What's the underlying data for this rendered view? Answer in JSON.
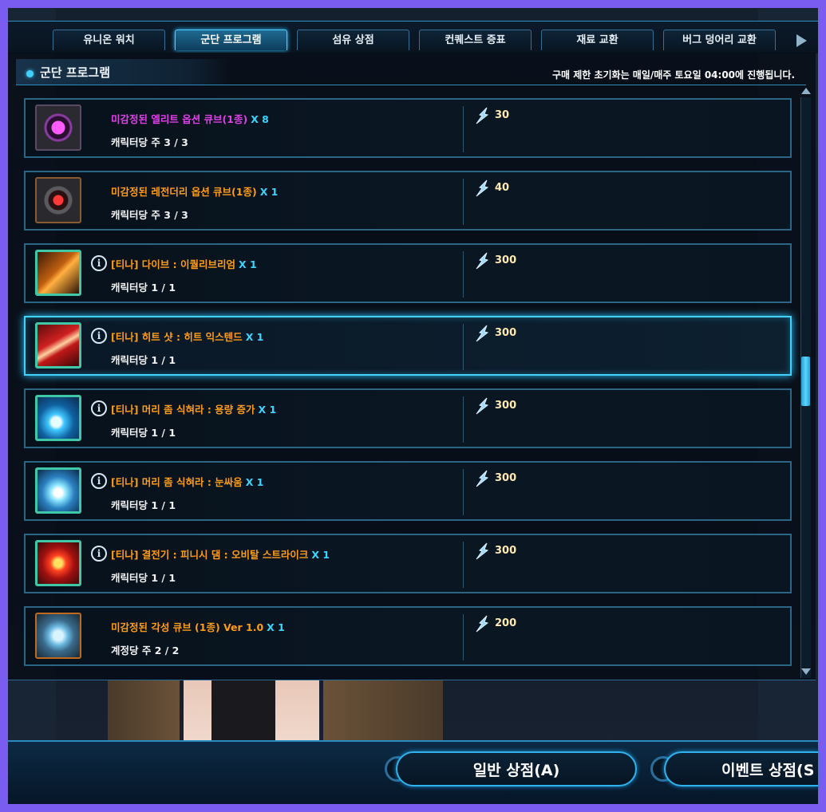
{
  "tabs": [
    {
      "label": "유니온 워치",
      "active": false
    },
    {
      "label": "군단 프로그램",
      "active": true
    },
    {
      "label": "섬유 상점",
      "active": false
    },
    {
      "label": "컨퀘스트 증표",
      "active": false
    },
    {
      "label": "재료 교환",
      "active": false
    },
    {
      "label": "버그 덩어리 교환",
      "active": false
    }
  ],
  "section": {
    "title": "군단 프로그램",
    "notice": "구매 제한 초기화는 매일/매주 토요일 04:00에 진행됩니다."
  },
  "items": [
    {
      "name": "미감정된 엘리트 옵션 큐브(1종)",
      "qty": "X 8",
      "limit": "캐릭터당 주 3 / 3",
      "price": "30",
      "info": false,
      "name_color": "purple",
      "icon": "elite-cube-icon"
    },
    {
      "name": "미감정된 레전더리 옵션 큐브(1종)",
      "qty": "X 1",
      "limit": "캐릭터당 주 3 / 3",
      "price": "40",
      "info": false,
      "name_color": "orange",
      "icon": "legendary-cube-icon"
    },
    {
      "name": "[티나] 다이브 : 이퀄리브리엄",
      "qty": "X 1",
      "limit": "캐릭터당 1 / 1",
      "price": "300",
      "info": true,
      "name_color": "orange",
      "icon": "skill-dive-icon"
    },
    {
      "name": "[티나] 히트 샷 : 히트 익스텐드",
      "qty": "X 1",
      "limit": "캐릭터당 1 / 1",
      "price": "300",
      "info": true,
      "name_color": "orange",
      "icon": "skill-heat-shot-icon",
      "selected": true
    },
    {
      "name": "[티나] 머리 좀 식혀라 : 용량 증가",
      "qty": "X 1",
      "limit": "캐릭터당 1 / 1",
      "price": "300",
      "info": true,
      "name_color": "orange",
      "icon": "skill-cool-head-icon"
    },
    {
      "name": "[티나] 머리 좀 식혀라 : 눈싸움",
      "qty": "X 1",
      "limit": "캐릭터당 1 / 1",
      "price": "300",
      "info": true,
      "name_color": "orange",
      "icon": "skill-snowball-icon"
    },
    {
      "name": "[티나] 결전기 : 피니시 댐 : 오비탈 스트라이크",
      "qty": "X 1",
      "limit": "캐릭터당 1 / 1",
      "price": "300",
      "info": true,
      "name_color": "orange",
      "icon": "skill-orbital-strike-icon"
    },
    {
      "name": "미감정된 각성 큐브 (1종) Ver 1.0",
      "qty": "X 1",
      "limit": "계정당 주 2 / 2",
      "price": "200",
      "info": false,
      "name_color": "orange",
      "icon": "awakening-cube-icon"
    }
  ],
  "buttons": {
    "general_shop": "일반 상점(A)",
    "event_shop": "이벤트 상점(S"
  },
  "colors": {
    "accent": "#3fd4ff",
    "item_name": "#ff9c1a",
    "elite_name": "#e040e8",
    "qty": "#3ad6ff",
    "frame": "#7b5cf0"
  }
}
